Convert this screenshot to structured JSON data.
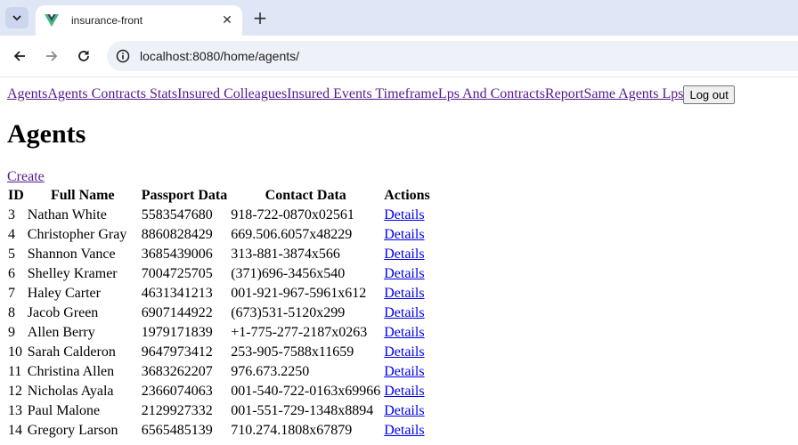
{
  "browser": {
    "tab_title": "insurance-front",
    "url": "localhost:8080/home/agents/"
  },
  "nav": {
    "links": [
      "Agents",
      "Agents Contracts Stats",
      "Insured Colleagues",
      "Insured Events Timeframe",
      "Lps And Contracts",
      "Report",
      "Same Agents Lps"
    ],
    "logout_label": "Log out"
  },
  "page": {
    "heading": "Agents",
    "create_label": "Create"
  },
  "table": {
    "headers": [
      "ID",
      "Full Name",
      "Passport Data",
      "Contact Data",
      "Actions"
    ],
    "rows": [
      {
        "id": "3",
        "name": "Nathan White",
        "passport": "5583547680",
        "contact": "918-722-0870x02561",
        "action": "Details"
      },
      {
        "id": "4",
        "name": "Christopher Gray",
        "passport": "8860828429",
        "contact": "669.506.6057x48229",
        "action": "Details"
      },
      {
        "id": "5",
        "name": "Shannon Vance",
        "passport": "3685439006",
        "contact": "313-881-3874x566",
        "action": "Details"
      },
      {
        "id": "6",
        "name": "Shelley Kramer",
        "passport": "7004725705",
        "contact": "(371)696-3456x540",
        "action": "Details"
      },
      {
        "id": "7",
        "name": "Haley Carter",
        "passport": "4631341213",
        "contact": "001-921-967-5961x612",
        "action": "Details"
      },
      {
        "id": "8",
        "name": "Jacob Green",
        "passport": "6907144922",
        "contact": "(673)531-5120x299",
        "action": "Details"
      },
      {
        "id": "9",
        "name": "Allen Berry",
        "passport": "1979171839",
        "contact": "+1-775-277-2187x0263",
        "action": "Details"
      },
      {
        "id": "10",
        "name": "Sarah Calderon",
        "passport": "9647973412",
        "contact": "253-905-7588x11659",
        "action": "Details"
      },
      {
        "id": "11",
        "name": "Christina Allen",
        "passport": "3683262207",
        "contact": "976.673.2250",
        "action": "Details"
      },
      {
        "id": "12",
        "name": "Nicholas Ayala",
        "passport": "2366074063",
        "contact": "001-540-722-0163x69966",
        "action": "Details"
      },
      {
        "id": "13",
        "name": "Paul Malone",
        "passport": "2129927332",
        "contact": "001-551-729-1348x8894",
        "action": "Details"
      },
      {
        "id": "14",
        "name": "Gregory Larson",
        "passport": "6565485139",
        "contact": "710.274.1808x67879",
        "action": "Details"
      }
    ]
  }
}
